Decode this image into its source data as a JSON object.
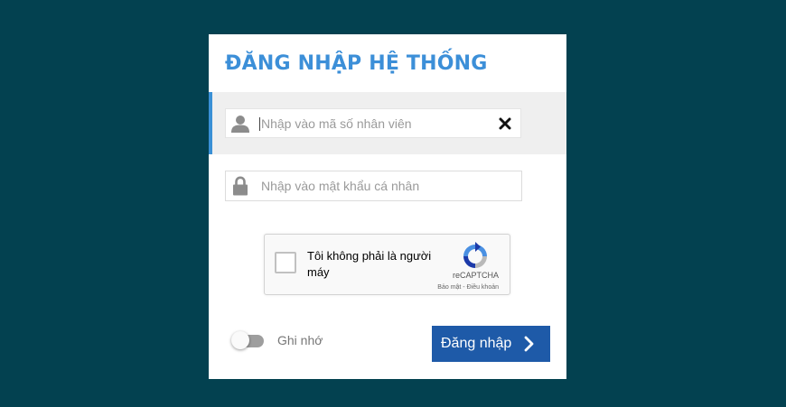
{
  "login": {
    "title": "ĐĂNG NHẬP HỆ THỐNG",
    "username": {
      "value": "",
      "placeholder": "Nhập vào mã số nhân viên",
      "icon": "user-icon",
      "clear_icon": "close-icon"
    },
    "password": {
      "value": "",
      "placeholder": "Nhập vào mật khẩu cá nhân",
      "icon": "lock-icon"
    },
    "captcha": {
      "label": "Tôi không phải là người máy",
      "brand": "reCAPTCHA",
      "terms": "Bảo mật - Điều khoản",
      "checked": false
    },
    "remember": {
      "label": "Ghi nhớ",
      "on": false
    },
    "submit": {
      "label": "Đăng nhập",
      "icon": "chevron-right-icon"
    }
  },
  "colors": {
    "background": "#034150",
    "title": "#3c8fd8",
    "accent_bar": "#3a90d6",
    "button": "#1e5aa8"
  }
}
